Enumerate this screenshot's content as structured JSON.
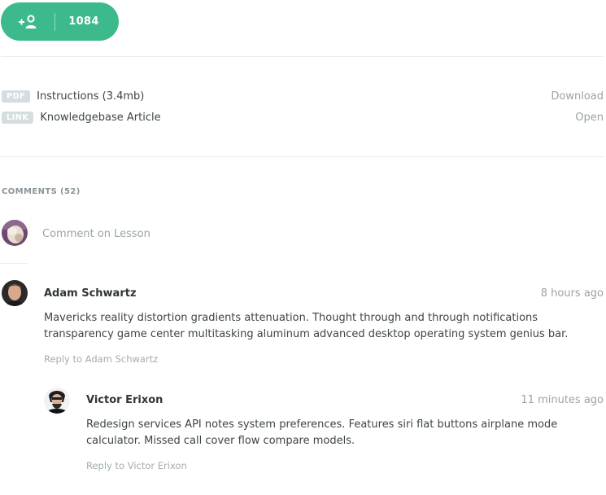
{
  "follow": {
    "count": "1084",
    "icon": "add-user-icon",
    "color": "#3dba8c"
  },
  "attachments": [
    {
      "badge": "PDF",
      "name": "Instructions (3.4mb)",
      "action": "Download"
    },
    {
      "badge": "LINK",
      "name": "Knowledgebase Article",
      "action": "Open"
    }
  ],
  "comments": {
    "heading": "COMMENTS (52)",
    "input_placeholder": "Comment on Lesson",
    "items": [
      {
        "author": "Adam Schwartz",
        "time": "8 hours ago",
        "text": "Mavericks reality distortion gradients attenuation. Thought through and through notifications transparency game center multitasking aluminum advanced desktop operating system genius bar.",
        "reply": "Reply to Adam Schwartz"
      },
      {
        "author": "Victor Erixon",
        "time": "11 minutes ago",
        "text": "Redesign services API notes system preferences. Features siri flat buttons airplane mode calculator. Missed call cover flow compare models.",
        "reply": "Reply to Victor Erixon"
      }
    ]
  }
}
